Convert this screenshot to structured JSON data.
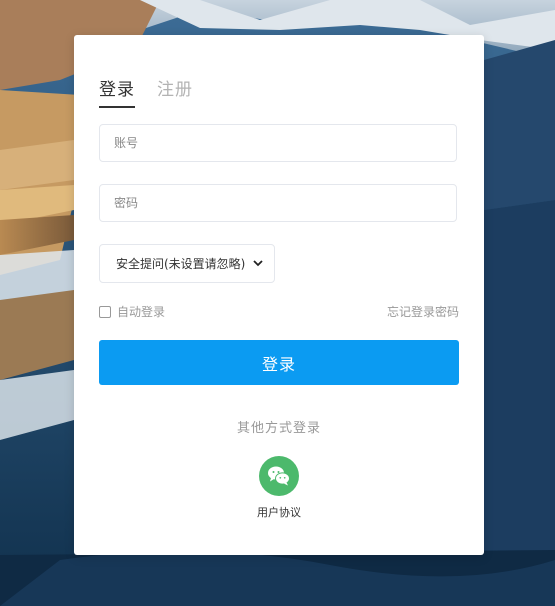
{
  "tabs": {
    "login_label": "登录",
    "register_label": "注册"
  },
  "form": {
    "account_placeholder": "账号",
    "password_placeholder": "密码",
    "security_question_selected": "安全提问(未设置请忽略)",
    "remember_label": "自动登录",
    "forgot_label": "忘记登录密码",
    "submit_label": "登录"
  },
  "social": {
    "other_methods_label": "其他方式登录",
    "wechat_icon": "wechat-icon",
    "agreement_label": "用户协议"
  },
  "colors": {
    "primary": "#0b9bf2",
    "wechat": "#4cb96c"
  }
}
